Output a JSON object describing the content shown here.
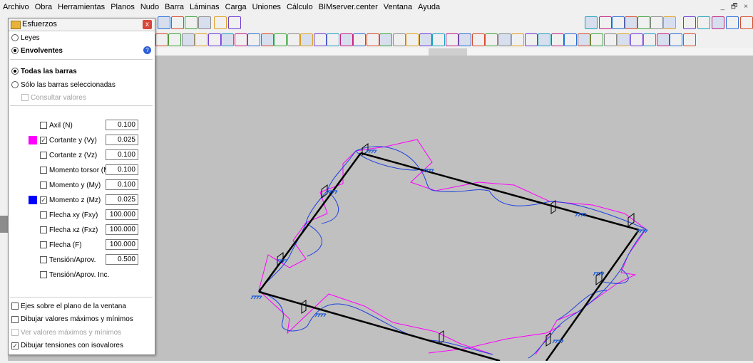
{
  "menu": [
    "Archivo",
    "Obra",
    "Herramientas",
    "Planos",
    "Nudo",
    "Barra",
    "Láminas",
    "Carga",
    "Uniones",
    "Cálculo",
    "BIMserver.center",
    "Ventana",
    "Ayuda"
  ],
  "window_controls": "_ 🗗 ×",
  "panel": {
    "title": "Esfuerzos",
    "close_label": "x",
    "mode_leyes": "Leyes",
    "mode_envolventes": "Envolventes",
    "scope_all": "Todas las barras",
    "scope_selected": "Sólo las barras seleccionadas",
    "consult_values": "Consultar valores",
    "efforts": [
      {
        "label": "Axil (N)",
        "value": "0.100",
        "checked": false,
        "color": ""
      },
      {
        "label": "Cortante y (Vy)",
        "value": "0.025",
        "checked": true,
        "color": "#ff00ff"
      },
      {
        "label": "Cortante z (Vz)",
        "value": "0.100",
        "checked": false,
        "color": ""
      },
      {
        "label": "Momento torsor (Mt)",
        "value": "0.100",
        "checked": false,
        "color": ""
      },
      {
        "label": "Momento y (My)",
        "value": "0.100",
        "checked": false,
        "color": ""
      },
      {
        "label": "Momento z (Mz)",
        "value": "0.025",
        "checked": true,
        "color": "#0000ff"
      },
      {
        "label": "Flecha xy (Fxy)",
        "value": "100.000",
        "checked": false,
        "color": ""
      },
      {
        "label": "Flecha xz (Fxz)",
        "value": "100.000",
        "checked": false,
        "color": ""
      },
      {
        "label": "Flecha (F)",
        "value": "100.000",
        "checked": false,
        "color": ""
      },
      {
        "label": "Tensión/Aprov.",
        "value": "0.500",
        "checked": false,
        "color": ""
      },
      {
        "label": "Tensión/Aprov. Inc.",
        "value": "",
        "checked": false,
        "color": ""
      }
    ],
    "options": [
      {
        "label": "Ejes sobre el plano de la ventana",
        "checked": false,
        "disabled": false
      },
      {
        "label": "Dibujar valores máximos y mínimos",
        "checked": false,
        "disabled": false
      },
      {
        "label": "Ver valores máximos y mínimos",
        "checked": false,
        "disabled": true
      },
      {
        "label": "Dibujar tensiones con isovalores",
        "checked": true,
        "disabled": false
      }
    ]
  },
  "colors": {
    "canvas": "#c0c0c0",
    "structure": "#000000",
    "shear_vy": "#ff00ff",
    "moment_mz": "#0000ff",
    "support": "#1f5bd6"
  }
}
